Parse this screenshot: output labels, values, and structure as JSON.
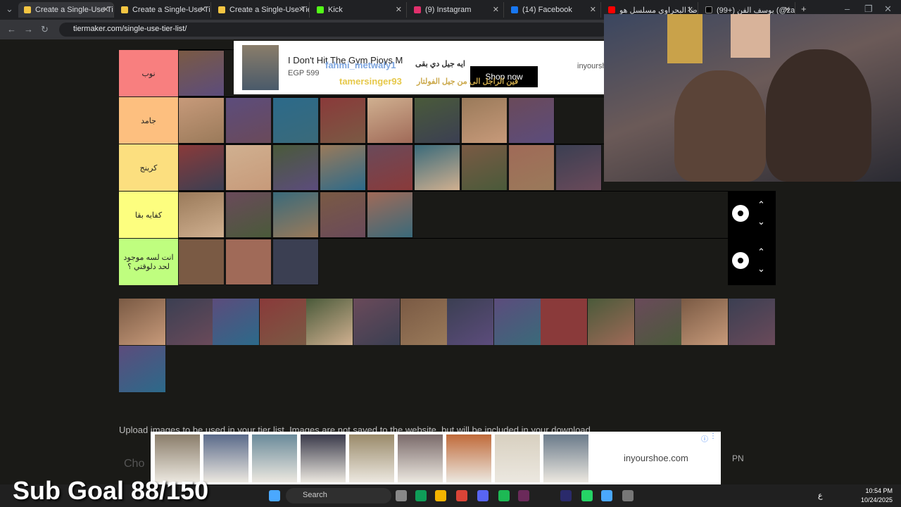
{
  "tabs": [
    {
      "label": "Create a Single-Use Tier L",
      "color": "#f4c542",
      "active": true
    },
    {
      "label": "Create a Single-Use Tier L",
      "color": "#f4c542"
    },
    {
      "label": "Create a Single-Use Tier L",
      "color": "#f4c542"
    },
    {
      "label": "Kick",
      "color": "#53fc18"
    },
    {
      "label": "(9) Instagram",
      "color": "#e1306c"
    },
    {
      "label": "(14) Facebook",
      "color": "#1877f2"
    },
    {
      "label": "رضا البحراوي مسلسل هو",
      "color": "#ff0000"
    },
    {
      "label": "(99+) يوسف الفن (@zaf1",
      "color": "#000000"
    }
  ],
  "address": {
    "url": "tiermaker.com/single-use-tier-list/"
  },
  "tiers": [
    {
      "label": "نوب",
      "color": "#f87f7f",
      "count": 1
    },
    {
      "label": "جامد",
      "color": "#fdbf7f",
      "count": 8
    },
    {
      "label": "كرينج",
      "color": "#fcdf7f",
      "count": 9
    },
    {
      "label": "كفايه بقا",
      "color": "#fdfe7f",
      "count": 5
    },
    {
      "label": "انت لسه موجود لحد دلوقتي ؟",
      "color": "#bffe7f",
      "count": 3
    }
  ],
  "pool_count": 15,
  "ad_top": {
    "title": "I Don't Hit The Gym Pjoys M",
    "price": "EGP 599",
    "button": "Shop now",
    "domain": "inyoursh"
  },
  "overlay": {
    "name1": "fahmi_metwaly1",
    "name2": "tamersinger93",
    "arabic1": "ايه جيل دي بقى",
    "arabic2": "فين الراجل الى من جيل الفولتار"
  },
  "upload_text": "Upload images to be used in your tier list. Images are not saved to the website, but will be included in your download.",
  "ad_bottom": {
    "domain": "inyourshoe.com",
    "initials": "PN",
    "partial": "Cho"
  },
  "stream": {
    "subgoal": "Sub Goal 88/150"
  },
  "taskbar": {
    "search": "Search",
    "time": "10:54 PM",
    "date": "10/24/2025",
    "lang": "ع"
  }
}
